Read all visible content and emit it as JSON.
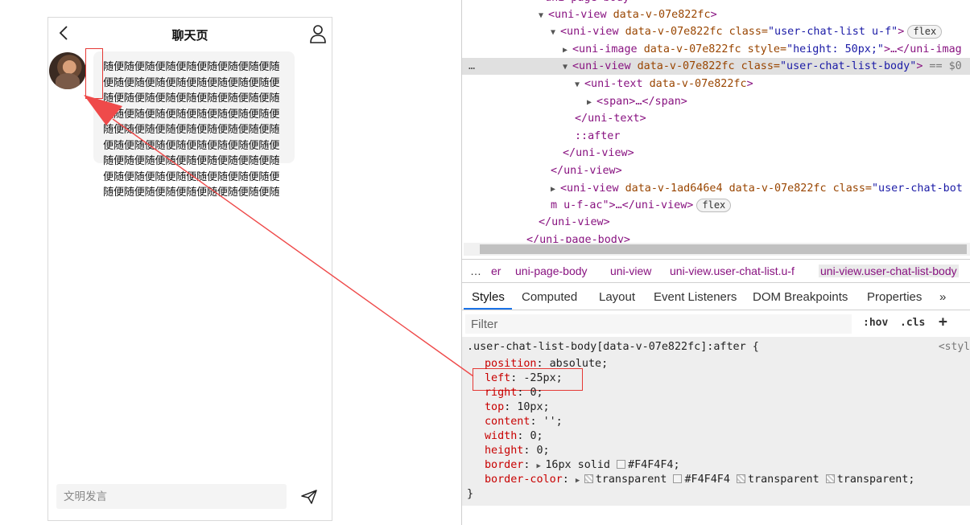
{
  "phone": {
    "title": "聊天页",
    "message": "随便随便随便随便随便随便随便随便随便随便随便随便随便随便随便随便随便随便随便随便随便随便随便随便随便随便随便随便随便随便随便随便随便随便随便随便随便随便随便随便随便随便随便随便随便随便随便随便随便随便随便随便随便随便随便随便随便随便随便随便随便随便随便随便随便随便随便随便随便随便随便随便随便随便随便随便随",
    "input_placeholder": "文明发言",
    "icons": {
      "back": "chevron-left-icon",
      "user": "user-icon",
      "send": "send-icon"
    }
  },
  "devtools": {
    "dom_lines": [
      {
        "text": "<uni-page-body>"
      },
      {
        "tag": "uni-view",
        "attrs": "data-v-07e822fc"
      },
      {
        "tag": "uni-view",
        "attrs": "data-v-07e822fc",
        "cls": "user-chat-list u-f",
        "badge": "flex"
      },
      {
        "tag": "uni-image",
        "attrs": "data-v-07e822fc",
        "style": "height: 50px;",
        "tail": "…</uni-imag"
      },
      {
        "tag": "uni-view",
        "attrs": "data-v-07e822fc",
        "cls": "user-chat-list-body",
        "suffix": "== $0"
      },
      {
        "tag": "uni-text",
        "attrs": "data-v-07e822fc"
      },
      {
        "text": "<span>…</span>"
      },
      {
        "text": "</uni-text>"
      },
      {
        "text": "::after"
      },
      {
        "text": "</uni-view>"
      },
      {
        "text": "</uni-view>"
      },
      {
        "tag": "uni-view",
        "attrs": "data-v-1ad646e4 data-v-07e822fc",
        "cls": "user-chat-bot"
      },
      {
        "text": "m u-f-ac\">…</uni-view>",
        "badge": "flex"
      },
      {
        "text": "</uni-view>"
      },
      {
        "text": "</uni-page-body>"
      }
    ],
    "ellipsis": "…",
    "breadcrumbs": [
      "…",
      "er",
      "uni-page-body",
      "uni-view",
      "uni-view.user-chat-list.u-f",
      "uni-view.user-chat-list-body"
    ],
    "tabs": [
      "Styles",
      "Computed",
      "Layout",
      "Event Listeners",
      "DOM Breakpoints",
      "Properties"
    ],
    "tabs_more": "»",
    "filter_placeholder": "Filter",
    "hov": ":hov",
    "cls": ".cls",
    "plus": "+",
    "rule": {
      "selector": ".user-chat-list-body[data-v-07e822fc]:after {",
      "source": "<styl",
      "props": [
        {
          "name": "position",
          "value": "absolute;"
        },
        {
          "name": "left",
          "value": "-25px;"
        },
        {
          "name": "right",
          "value": "0;"
        },
        {
          "name": "top",
          "value": "10px;"
        },
        {
          "name": "content",
          "value": "'';"
        },
        {
          "name": "width",
          "value": "0;"
        },
        {
          "name": "height",
          "value": "0;"
        },
        {
          "name": "border",
          "value": "16px solid #F4F4F4;"
        },
        {
          "name": "border-color",
          "value": "transparent #F4F4F4 transparent transparent;"
        }
      ],
      "close": "}"
    }
  },
  "colors": {
    "highlight": "#e53935",
    "bubble": "#f4f4f4",
    "accent": "#1a73e8"
  }
}
